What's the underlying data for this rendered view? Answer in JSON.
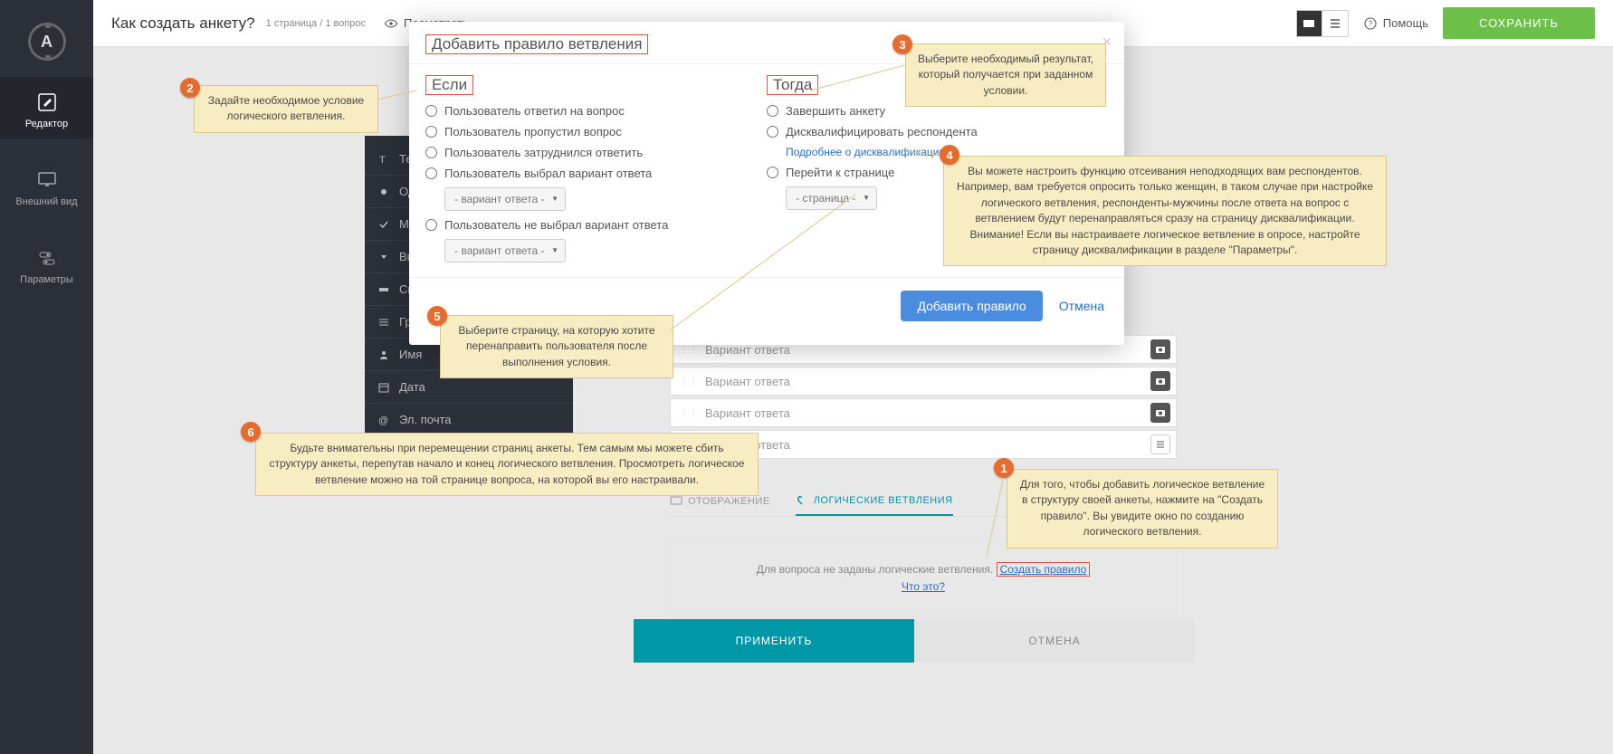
{
  "topbar": {
    "title": "Как создать анкету?",
    "meta": "1 страница / 1 вопрос",
    "preview": "Посмотреть",
    "help": "Помощь",
    "save": "СОХРАНИТЬ"
  },
  "sidebar": {
    "logo_letter": "A",
    "items": [
      {
        "label": "Редактор"
      },
      {
        "label": "Внешний вид"
      },
      {
        "label": "Параметры"
      }
    ]
  },
  "toolbox": {
    "rows": [
      "Те",
      "Од",
      "Мн",
      "Вы",
      "Св",
      "Группа",
      "Имя",
      "Дата",
      "Эл. почта"
    ]
  },
  "editor": {
    "answer_placeholder": "Вариант ответа",
    "tabs": {
      "display": "ОТОБРАЖЕНИЕ",
      "logic": "ЛОГИЧЕСКИЕ ВЕТВЛЕНИЯ"
    },
    "rule_box_prefix": "Для вопроса не заданы логические ветвления. ",
    "create_rule": "Создать правило",
    "what_is": "Что это?",
    "apply": "ПРИМЕНИТЬ",
    "cancel": "ОТМЕНА"
  },
  "modal": {
    "title": "Добавить правило ветвления",
    "if_header": "Если",
    "then_header": "Тогда",
    "if_options": [
      "Пользователь ответил на вопрос",
      "Пользователь пропустил вопрос",
      "Пользователь затруднился ответить",
      "Пользователь выбрал вариант ответа",
      "Пользователь не выбрал вариант ответа"
    ],
    "answer_select": "- вариант ответа -",
    "then_options": [
      "Завершить анкету",
      "Дисквалифицировать респондента",
      "Перейти к странице"
    ],
    "disq_link": "Подробнее о дисквалификации",
    "page_select": "- страница -",
    "add_rule": "Добавить правило",
    "cancel": "Отмена"
  },
  "callouts": {
    "c1": "Для того, чтобы добавить логическое ветвление в структуру своей анкеты, нажмите на \"Создать правило\". Вы увидите окно по созданию логического ветвления.",
    "c2": "Задайте необходимое условие логического ветвления.",
    "c3": "Выберите необходимый результат, который получается при заданном условии.",
    "c4": "Вы можете настроить функцию отсеивания неподходящих вам респондентов. Например, вам требуется опросить только женщин, в таком случае при настройке логического ветвления, респонденты-мужчины после ответа на вопрос с ветвлением будут перенаправляться сразу на страницу дисквалификации.\nВнимание! Если вы настраиваете логическое ветвление в опросе, настройте страницу дисквалификации в разделе \"Параметры\".",
    "c5": "Выберите страницу, на которую хотите перенаправить пользователя после выполнения условия.",
    "c6": "Будьте внимательны при перемещении страниц анкеты. Тем самым мы можете сбить структуру анкеты, перепутав начало и конец логического ветвления.\nПросмотреть логическое ветвление можно на той странице вопроса, на которой вы его настраивали."
  }
}
